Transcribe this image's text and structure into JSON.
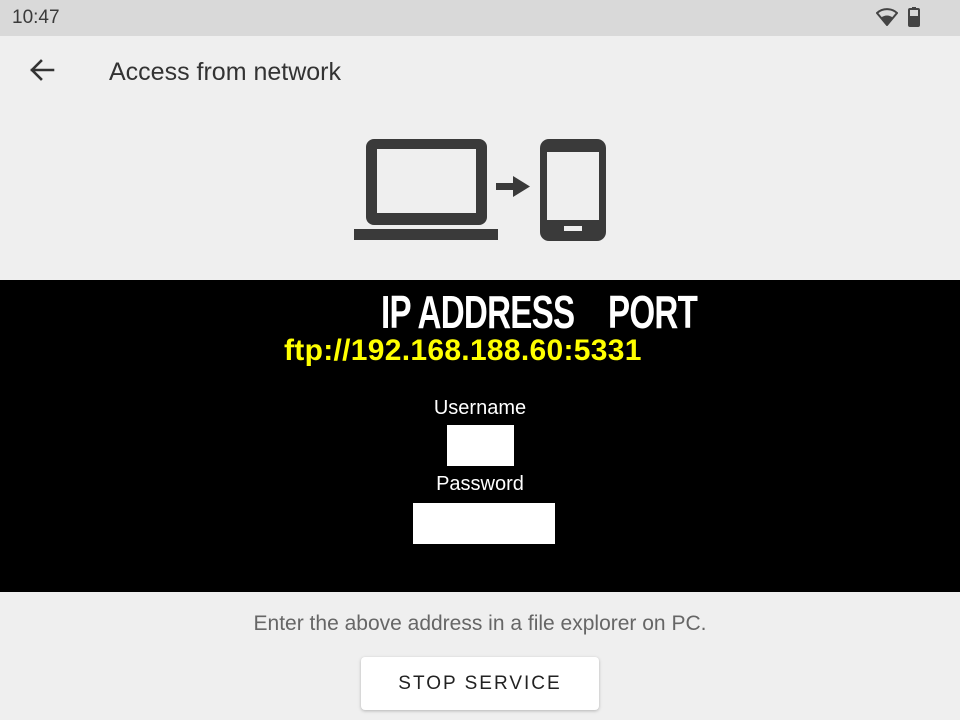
{
  "status_bar": {
    "time": "10:47",
    "icons": [
      "wifi-icon",
      "battery-icon"
    ]
  },
  "app_bar": {
    "title": "Access from network",
    "back_icon": "arrow-left-icon"
  },
  "illustration": {
    "icons": [
      "laptop-icon",
      "arrow-right-icon",
      "phone-icon"
    ]
  },
  "connection_panel": {
    "ip_header": "IP ADDRESS",
    "port_header": "PORT",
    "ftp_url": "ftp://192.168.188.60:5331",
    "username_label": "Username",
    "username_value": "",
    "password_label": "Password",
    "password_value": ""
  },
  "hint": "Enter the above address in a file explorer on PC.",
  "stop_button": "STOP SERVICE",
  "colors": {
    "panel_bg": "#000000",
    "url_color": "#ffff00",
    "page_bg": "#efefef"
  }
}
